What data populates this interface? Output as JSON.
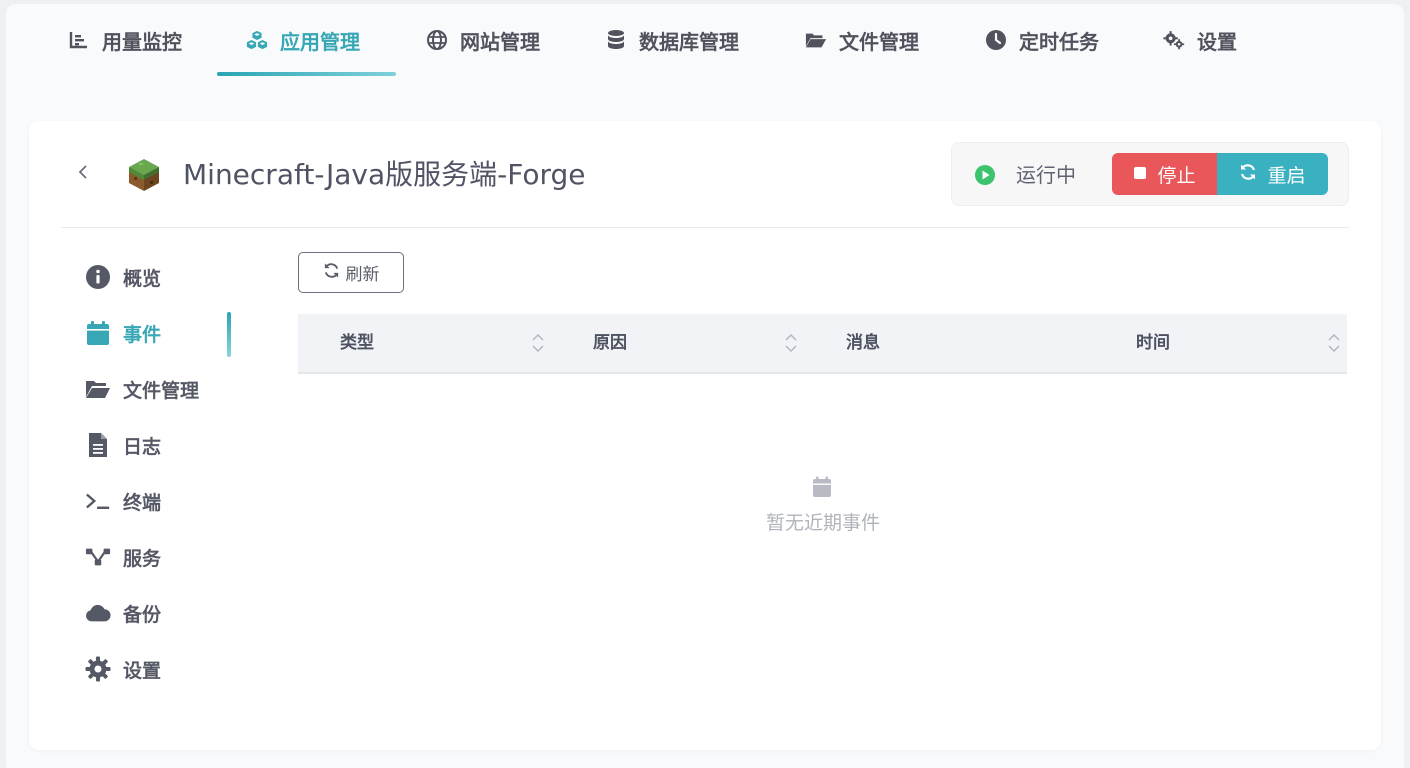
{
  "topnav": {
    "items": [
      {
        "label": "用量监控",
        "icon": "chart-bar-icon"
      },
      {
        "label": "应用管理",
        "icon": "cubes-icon",
        "active": true
      },
      {
        "label": "网站管理",
        "icon": "globe-icon"
      },
      {
        "label": "数据库管理",
        "icon": "database-icon"
      },
      {
        "label": "文件管理",
        "icon": "folder-open-icon"
      },
      {
        "label": "定时任务",
        "icon": "clock-icon"
      },
      {
        "label": "设置",
        "icon": "cogs-icon"
      }
    ]
  },
  "app": {
    "title": "Minecraft-Java版服务端-Forge",
    "logo": "minecraft-grass-block-icon",
    "status": "运行中",
    "stop_label": "停止",
    "restart_label": "重启"
  },
  "sidebar": {
    "items": [
      {
        "label": "概览",
        "icon": "info-circle-icon"
      },
      {
        "label": "事件",
        "icon": "calendar-icon",
        "active": true
      },
      {
        "label": "文件管理",
        "icon": "folder-open-icon"
      },
      {
        "label": "日志",
        "icon": "file-text-icon"
      },
      {
        "label": "终端",
        "icon": "terminal-icon"
      },
      {
        "label": "服务",
        "icon": "sitemap-icon"
      },
      {
        "label": "备份",
        "icon": "cloud-icon"
      },
      {
        "label": "设置",
        "icon": "cog-icon"
      }
    ]
  },
  "events": {
    "refresh_label": "刷新",
    "columns": [
      "类型",
      "原因",
      "消息",
      "时间"
    ],
    "empty_text": "暂无近期事件"
  },
  "colors": {
    "accent": "#37a7b6",
    "stop": "#e9575a",
    "restart": "#3ab1c0",
    "running": "#3cc36d"
  }
}
